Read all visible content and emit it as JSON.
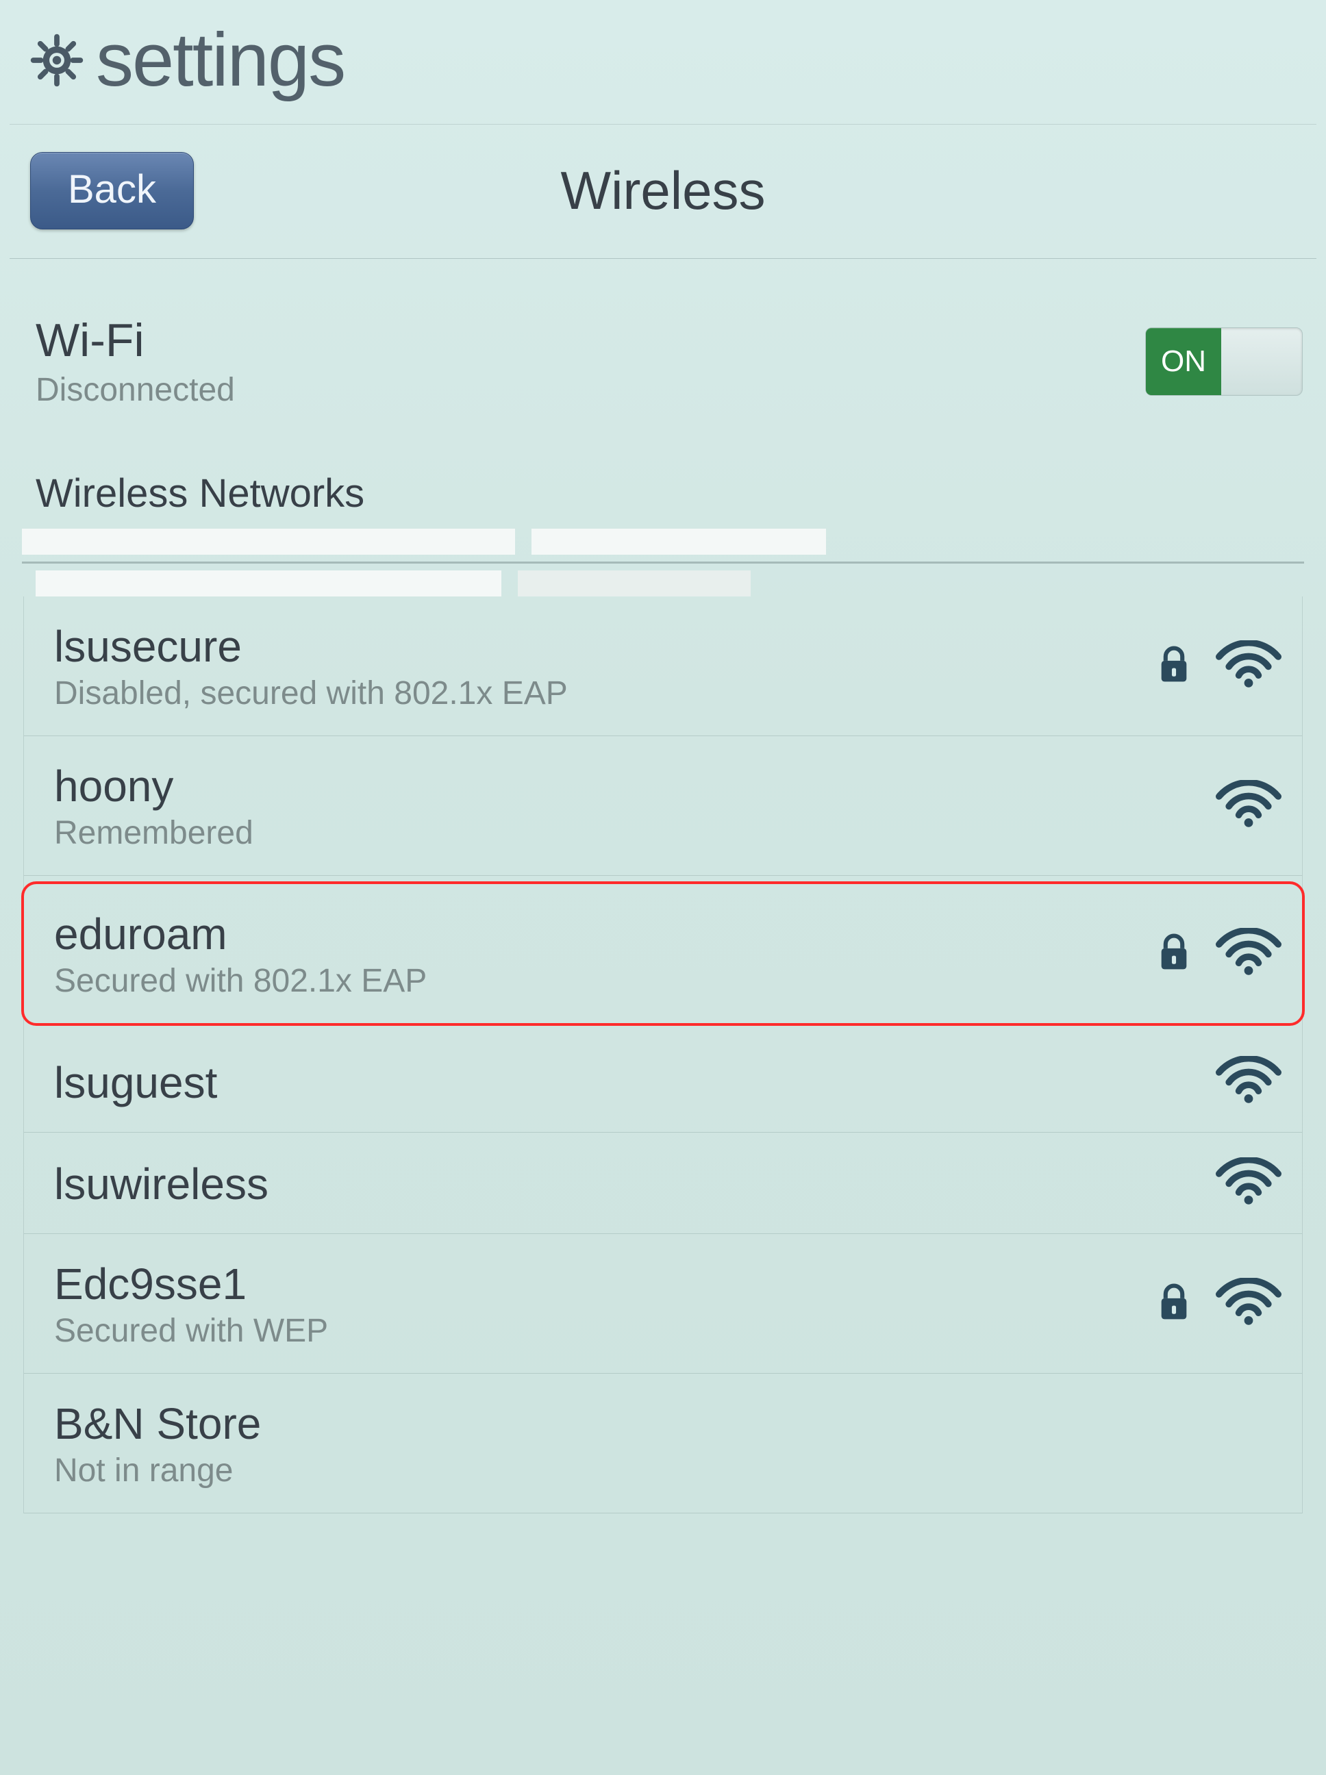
{
  "header": {
    "app_title": "settings"
  },
  "subheader": {
    "back_label": "Back",
    "page_title": "Wireless"
  },
  "wifi_status": {
    "title": "Wi-Fi",
    "subtitle": "Disconnected",
    "toggle_state": "ON"
  },
  "section_label": "Wireless Networks",
  "networks": [
    {
      "name": "lsusecure",
      "sub": "Disabled, secured with 802.1x EAP",
      "locked": true,
      "signal": "strong",
      "highlight": false
    },
    {
      "name": "hoony",
      "sub": "Remembered",
      "locked": false,
      "signal": "weak",
      "highlight": false
    },
    {
      "name": "eduroam",
      "sub": "Secured with 802.1x EAP",
      "locked": true,
      "signal": "strong",
      "highlight": true
    },
    {
      "name": "lsuguest",
      "sub": "",
      "locked": false,
      "signal": "strong",
      "highlight": false
    },
    {
      "name": "lsuwireless",
      "sub": "",
      "locked": false,
      "signal": "strong",
      "highlight": false
    },
    {
      "name": "Edc9sse1",
      "sub": "Secured with WEP",
      "locked": true,
      "signal": "strong",
      "highlight": false
    },
    {
      "name": "B&N Store",
      "sub": "Not in range",
      "locked": false,
      "signal": "none",
      "highlight": false
    }
  ]
}
